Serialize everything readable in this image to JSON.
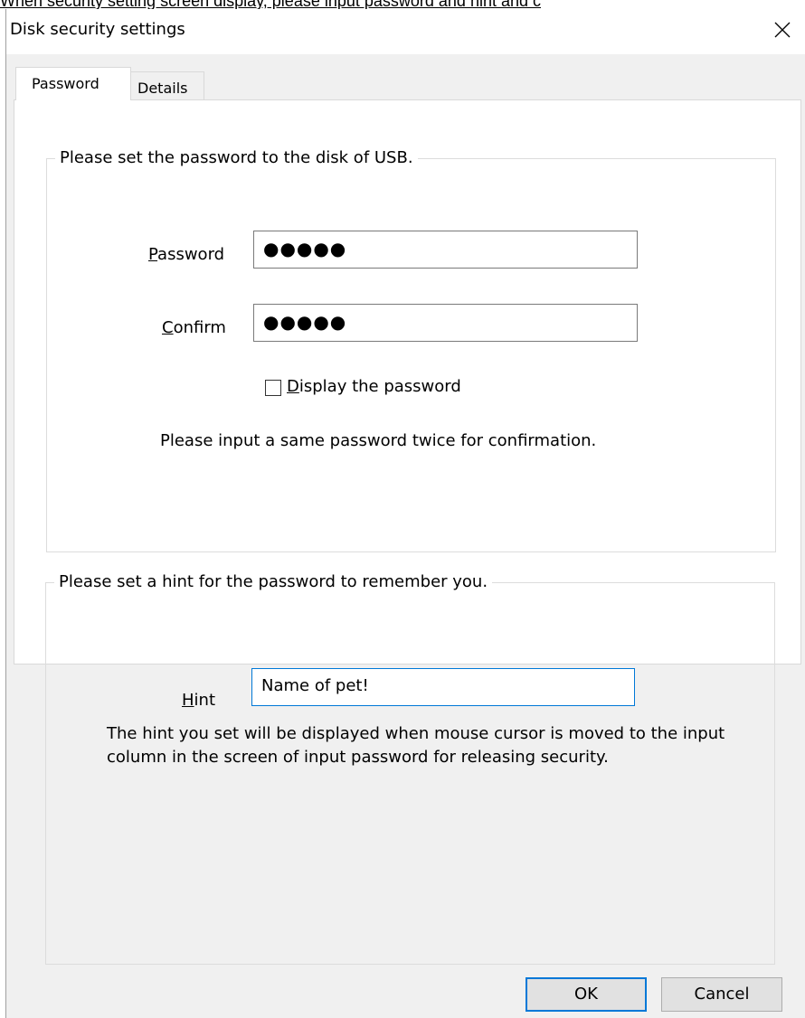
{
  "caption": "When security setting screen display, please input password and hint and c",
  "window": {
    "title": "Disk security settings",
    "close_icon": "close-icon"
  },
  "tabs": [
    {
      "label": "Password",
      "selected": true
    },
    {
      "label": "Details",
      "selected": false
    }
  ],
  "password_group": {
    "legend": "Please set the password to the disk of USB.",
    "password_label_access": "P",
    "password_label_rest": "assword",
    "password_value": "●●●●●",
    "confirm_label_access": "C",
    "confirm_label_rest": "onfirm",
    "confirm_value": "●●●●●",
    "display_checkbox_access": "D",
    "display_checkbox_rest": "isplay the password",
    "display_checked": false,
    "note": "Please input a same password twice for confirmation."
  },
  "hint_group": {
    "legend": "Please set a hint for the password to remember you.",
    "hint_label_access": "H",
    "hint_label_rest": "int",
    "hint_value": "Name of pet!",
    "note": "The hint you set will be displayed when mouse cursor is moved to the input column in the screen of input password for releasing security."
  },
  "buttons": {
    "ok": "OK",
    "cancel": "Cancel"
  },
  "colors": {
    "accent": "#0078d7",
    "dialog_bg": "#f0f0f0",
    "panel_bg": "#ffffff"
  }
}
